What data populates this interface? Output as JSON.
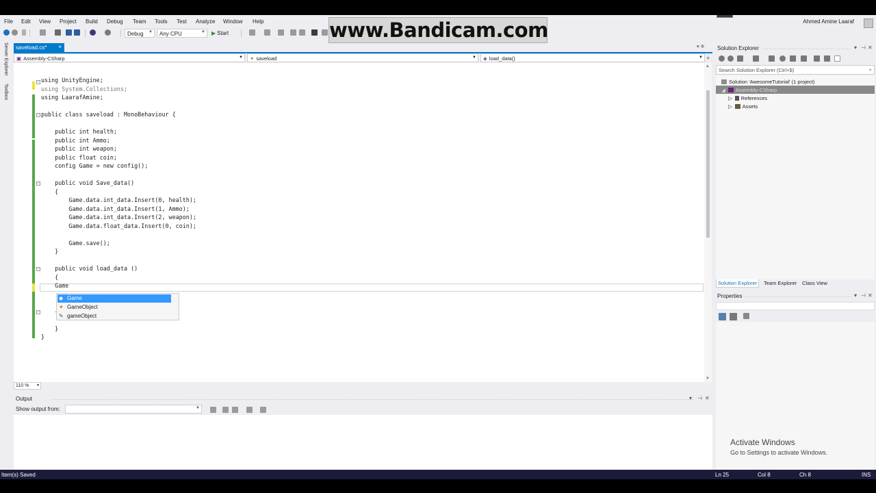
{
  "watermark": "www.Bandicam.com",
  "menu": [
    "File",
    "Edit",
    "View",
    "Project",
    "Build",
    "Debug",
    "Team",
    "Tools",
    "Test",
    "Analyze",
    "Window",
    "Help"
  ],
  "account": {
    "name": "Ahmed Amine Laaraf"
  },
  "toolbar": {
    "config": "Debug",
    "platform": "Any CPU",
    "start_label": "Start"
  },
  "side_tabs": [
    "Server Explorer",
    "Toolbox"
  ],
  "document_tab": {
    "title": "saveload.cs*",
    "close": "×"
  },
  "navbar": {
    "project": "Assembly-CSharp",
    "class": "saveload",
    "member": "load_data()"
  },
  "code_lines": [
    "using UnityEngine;",
    "using System.Collections;",
    "using LaarafAmine;",
    "",
    "public class saveload : MonoBehaviour {",
    "",
    "    public int health;",
    "    public int Ammo;",
    "    public int weapon;",
    "    public float coin;",
    "    config Game = new config();",
    "",
    "    public void Save_data()",
    "    {",
    "        Game.data.int_data.Insert(0, health);",
    "        Game.data.int_data.Insert(1, Ammo);",
    "        Game.data.int_data.Insert(2, weapon);",
    "        Game.data.float_data.Insert(0, coin);",
    "",
    "        Game.save();",
    "    }",
    "",
    "    public void load_data ()",
    "    {",
    "    Game",
    "",
    "",
    "    {",
    "",
    "    }",
    "}"
  ],
  "intellisense": [
    {
      "label": "Game",
      "icon": "field-icon"
    },
    {
      "label": "GameObject",
      "icon": "class-icon"
    },
    {
      "label": "gameObject",
      "icon": "property-icon"
    }
  ],
  "zoom": "110 %",
  "output": {
    "title": "Output",
    "show_output_from": "Show output from:"
  },
  "solution_explorer": {
    "title": "Solution Explorer",
    "search_placeholder": "Search Solution Explorer (Ctrl+$)",
    "items": [
      {
        "label": "Solution 'AwesomeTutorial' (1 project)",
        "indent": 0,
        "expander": "",
        "selected": false
      },
      {
        "label": "Assembly-CSharp",
        "indent": 1,
        "expander": "◢",
        "selected": true
      },
      {
        "label": "References",
        "indent": 2,
        "expander": "▷",
        "selected": false
      },
      {
        "label": "Assets",
        "indent": 2,
        "expander": "▷",
        "selected": false
      }
    ]
  },
  "pane_tabs": [
    "Solution Explorer",
    "Team Explorer",
    "Class View"
  ],
  "properties": {
    "title": "Properties"
  },
  "activate": {
    "title": "Activate Windows",
    "subtitle": "Go to Settings to activate Windows."
  },
  "status": {
    "message": "Item(s) Saved",
    "line": "Ln 25",
    "col": "Col 8",
    "ch": "Ch 8",
    "mode": "INS"
  },
  "colors": {
    "accent": "#007acc",
    "keyword": "#0000ff",
    "type": "#2b91af",
    "status_bar": "#1c1c3a",
    "changed_margin": "#57a64a"
  }
}
